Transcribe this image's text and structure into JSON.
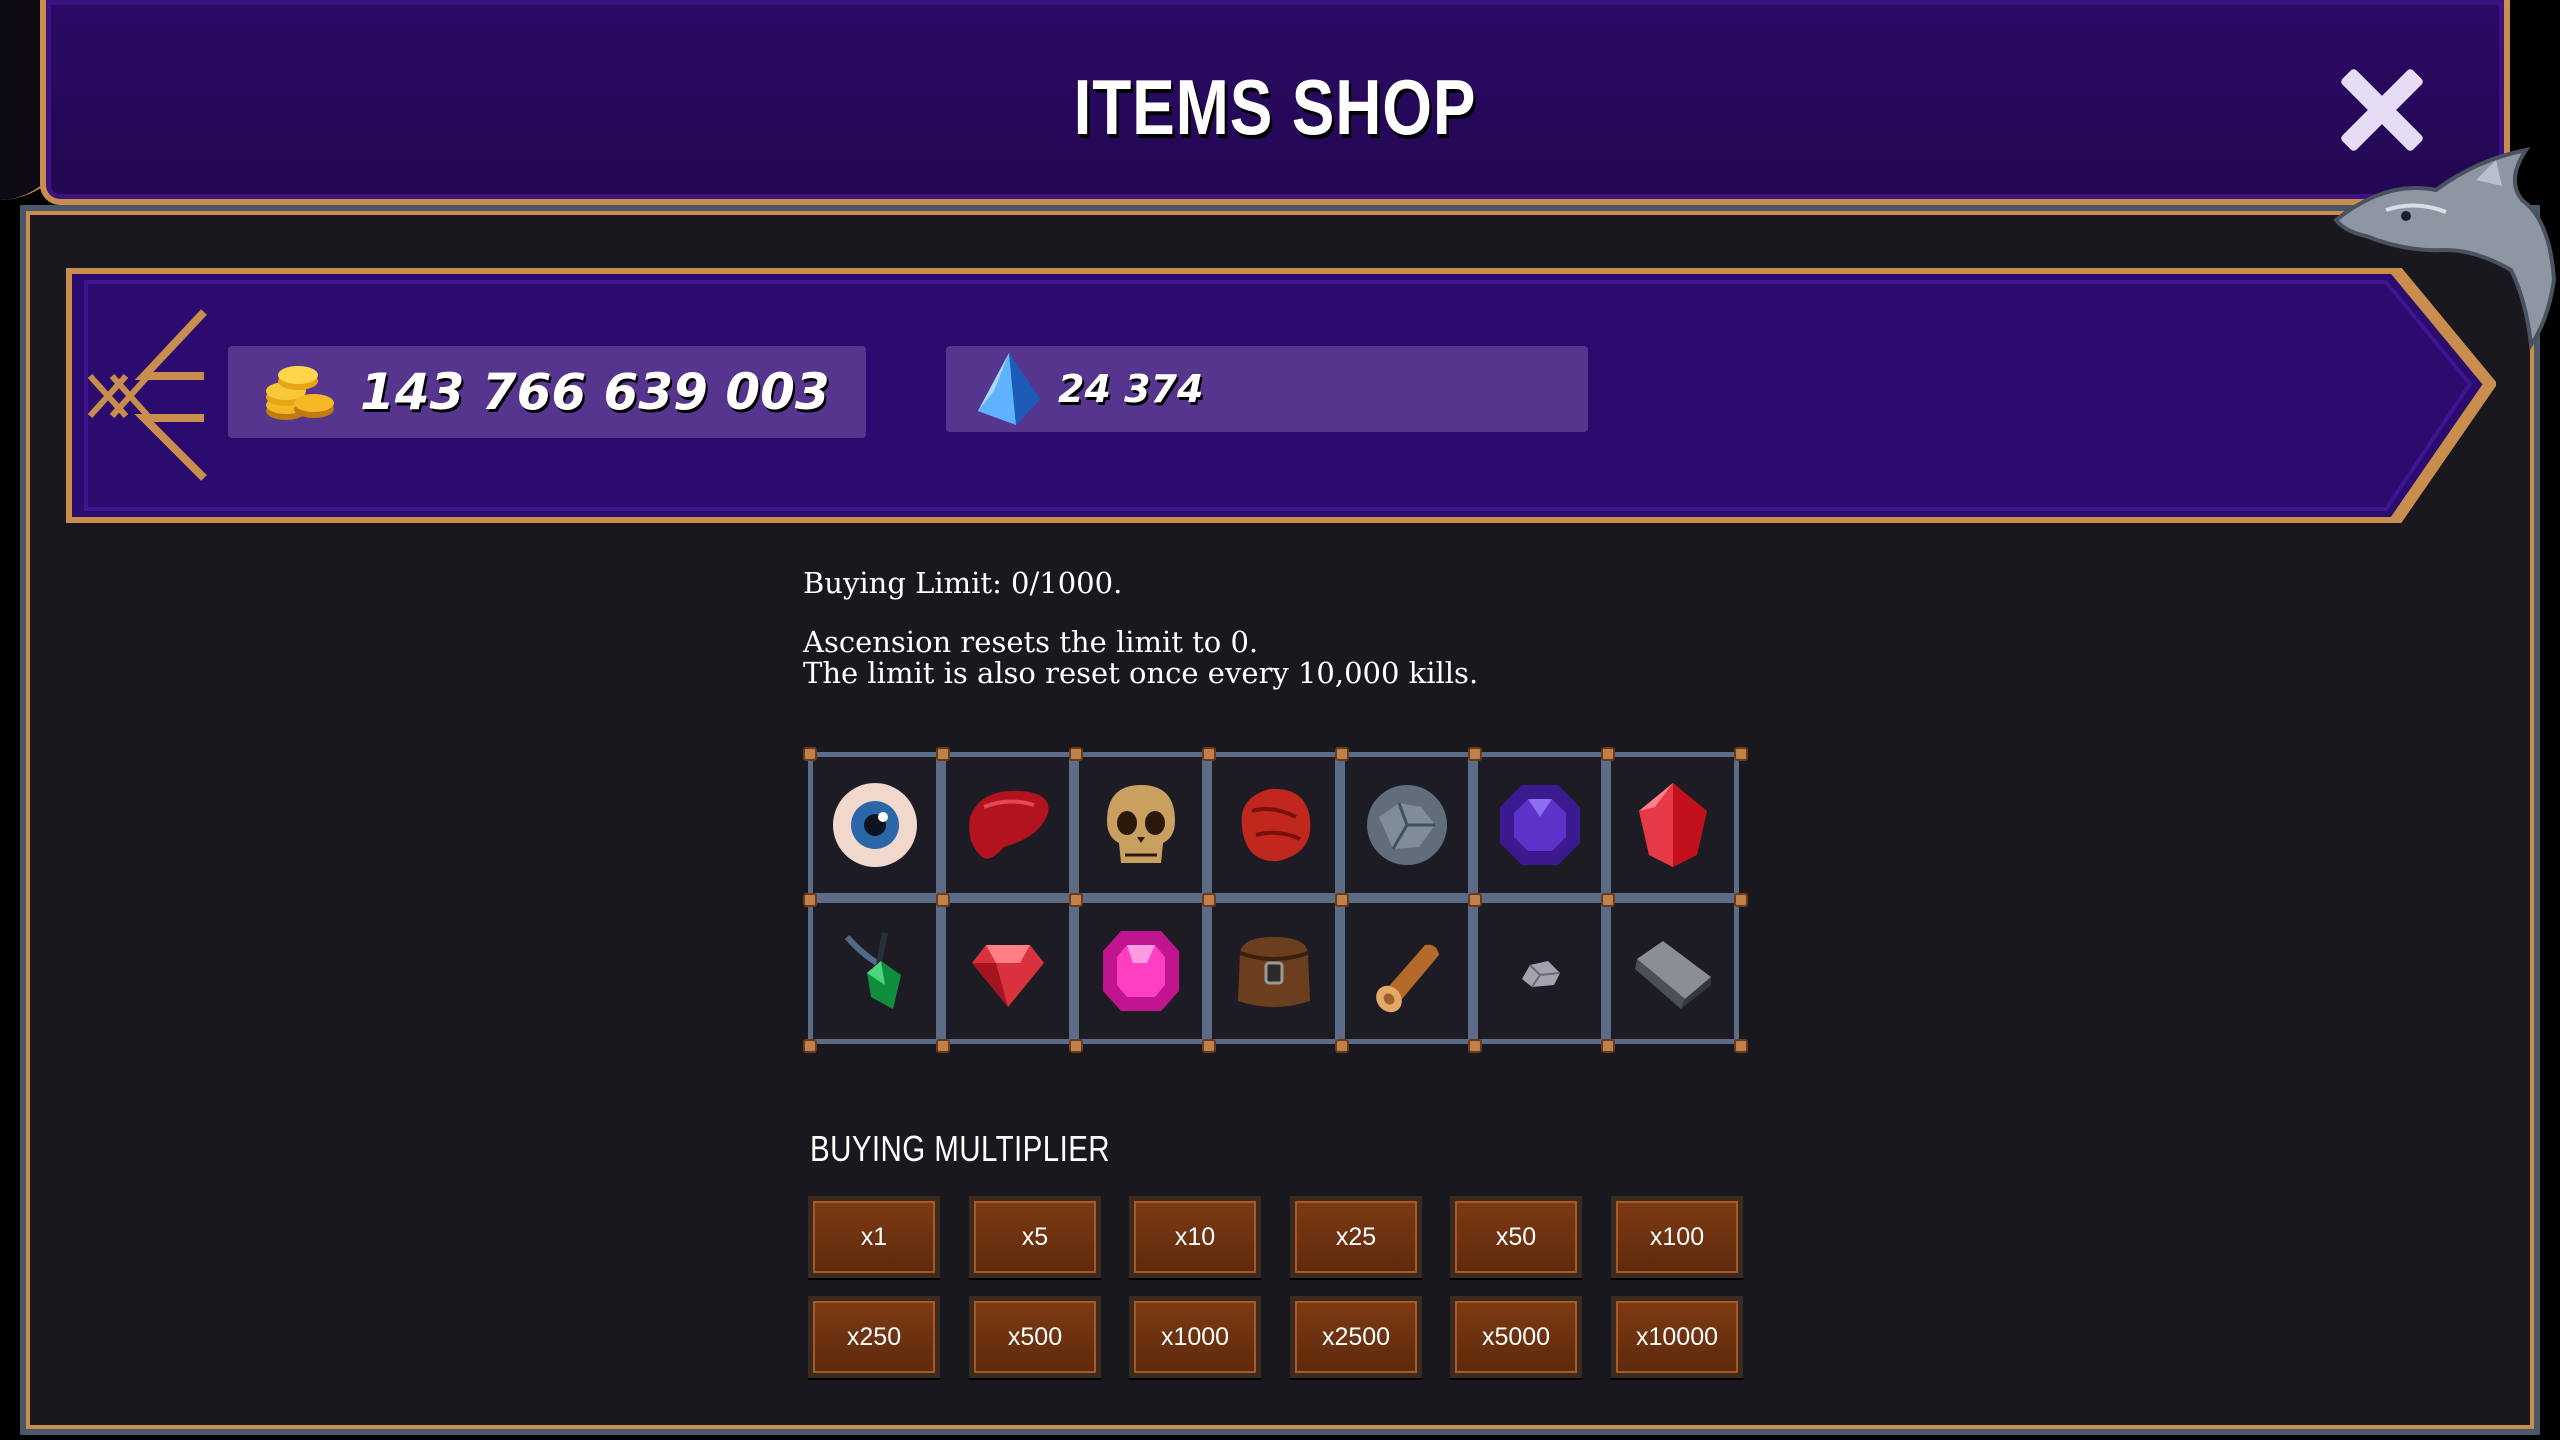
{
  "header": {
    "title": "ITEMS SHOP",
    "close_icon": "close-icon"
  },
  "currencies": {
    "gold": {
      "icon": "gold-coins-icon",
      "value": "143 766 639 003"
    },
    "gems": {
      "icon": "blue-diamond-icon",
      "value": "24 374"
    }
  },
  "info": {
    "buying_limit": "Buying Limit: 0/1000.",
    "reset_line1": "Ascension resets the limit to 0.",
    "reset_line2": "The limit is also reset once every 10,000 kills."
  },
  "items": [
    {
      "icon": "eyeball-icon"
    },
    {
      "icon": "liver-icon"
    },
    {
      "icon": "skull-icon"
    },
    {
      "icon": "red-ore-icon"
    },
    {
      "icon": "grey-stone-icon"
    },
    {
      "icon": "purple-gem-icon"
    },
    {
      "icon": "red-crystal-icon"
    },
    {
      "icon": "green-amulet-icon"
    },
    {
      "icon": "red-diamond-icon"
    },
    {
      "icon": "pink-gem-icon"
    },
    {
      "icon": "leather-pouch-icon"
    },
    {
      "icon": "wood-log-icon"
    },
    {
      "icon": "small-stone-icon"
    },
    {
      "icon": "iron-ingot-icon"
    }
  ],
  "multiplier": {
    "label": "BUYING MULTIPLIER",
    "options": [
      "x1",
      "x5",
      "x10",
      "x25",
      "x50",
      "x100",
      "x250",
      "x500",
      "x1000",
      "x2500",
      "x5000",
      "x10000"
    ]
  },
  "colors": {
    "header_purple": "#2a0a66",
    "banner_purple": "#2c0a6e",
    "gold_border": "#c98e4e",
    "panel_bg": "#19181f",
    "button_brown": "#7d3a13"
  }
}
